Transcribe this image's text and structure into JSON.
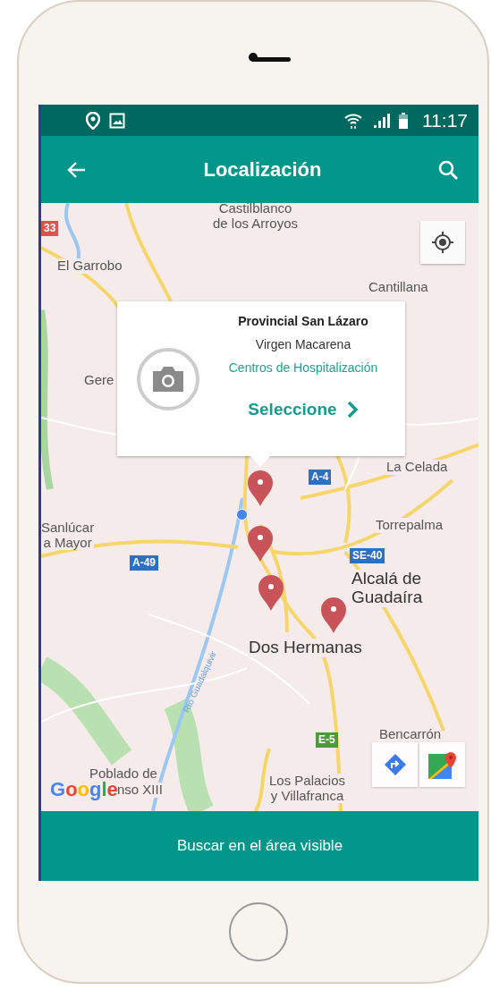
{
  "status_bar": {
    "time": "11:17"
  },
  "app_bar": {
    "title": "Localización"
  },
  "map": {
    "labels": [
      {
        "text": "Castilblanco\nde los Arroyos",
        "kind": "place"
      },
      {
        "text": "El Garrobo",
        "kind": "place"
      },
      {
        "text": "Cantillana",
        "kind": "place"
      },
      {
        "text": "Gere",
        "kind": "place"
      },
      {
        "text": "La Celada",
        "kind": "place"
      },
      {
        "text": "Sanlúcar\na Mayor",
        "kind": "place"
      },
      {
        "text": "Torrepalma",
        "kind": "place"
      },
      {
        "text": "Alcalá de\nGuadaíra",
        "kind": "place-large"
      },
      {
        "text": "Dos Hermanas",
        "kind": "place-large"
      },
      {
        "text": "Bencarrón",
        "kind": "place"
      },
      {
        "text": "Poblado de",
        "kind": "place"
      },
      {
        "text": "nso XIII",
        "kind": "place"
      },
      {
        "text": "Los Palacios\ny Villafranca",
        "kind": "place"
      },
      {
        "text": "Río Guadalquivir",
        "kind": "river"
      },
      {
        "text": "33",
        "kind": "shield-red"
      },
      {
        "text": "A-4",
        "kind": "shield-blue"
      },
      {
        "text": "A-49",
        "kind": "shield-blue"
      },
      {
        "text": "SE-40",
        "kind": "shield-blue"
      },
      {
        "text": "E-5",
        "kind": "shield-green"
      }
    ],
    "pins": [
      {
        "kind": "marker"
      },
      {
        "kind": "marker"
      },
      {
        "kind": "marker"
      },
      {
        "kind": "marker"
      }
    ],
    "popup": {
      "name": "Provincial San Lázaro",
      "area": "Virgen Macarena",
      "category": "Centros de Hospitalización",
      "action": "Seleccione"
    },
    "logo": "Google"
  },
  "bottom_button": {
    "label": "Buscar en el área visible"
  }
}
